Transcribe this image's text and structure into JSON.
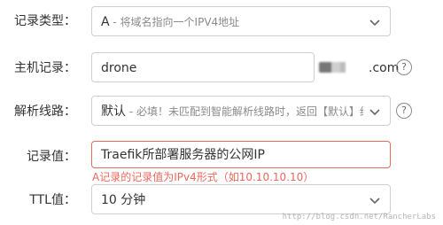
{
  "form": {
    "record_type": {
      "label": "记录类型：",
      "value_main": "A",
      "value_hint": " - 将域名指向一个IPV4地址"
    },
    "host": {
      "label": "主机记录：",
      "value": "drone",
      "suffix": ".com",
      "help": "?"
    },
    "line": {
      "label": "解析线路：",
      "value_main": "默认",
      "value_hint": " - 必填！未匹配到智能解析线路时，返回【默认】线路...",
      "help": "?"
    },
    "record_value": {
      "label": "记录值：",
      "value": "Traefik所部署服务器的公网IP",
      "error": "A记录的记录值为IPv4形式（如10.10.10.10）"
    },
    "ttl": {
      "label": "TTL值：",
      "value": "10 分钟"
    }
  },
  "watermark": "http://blog.csdn.net/RancherLabs"
}
